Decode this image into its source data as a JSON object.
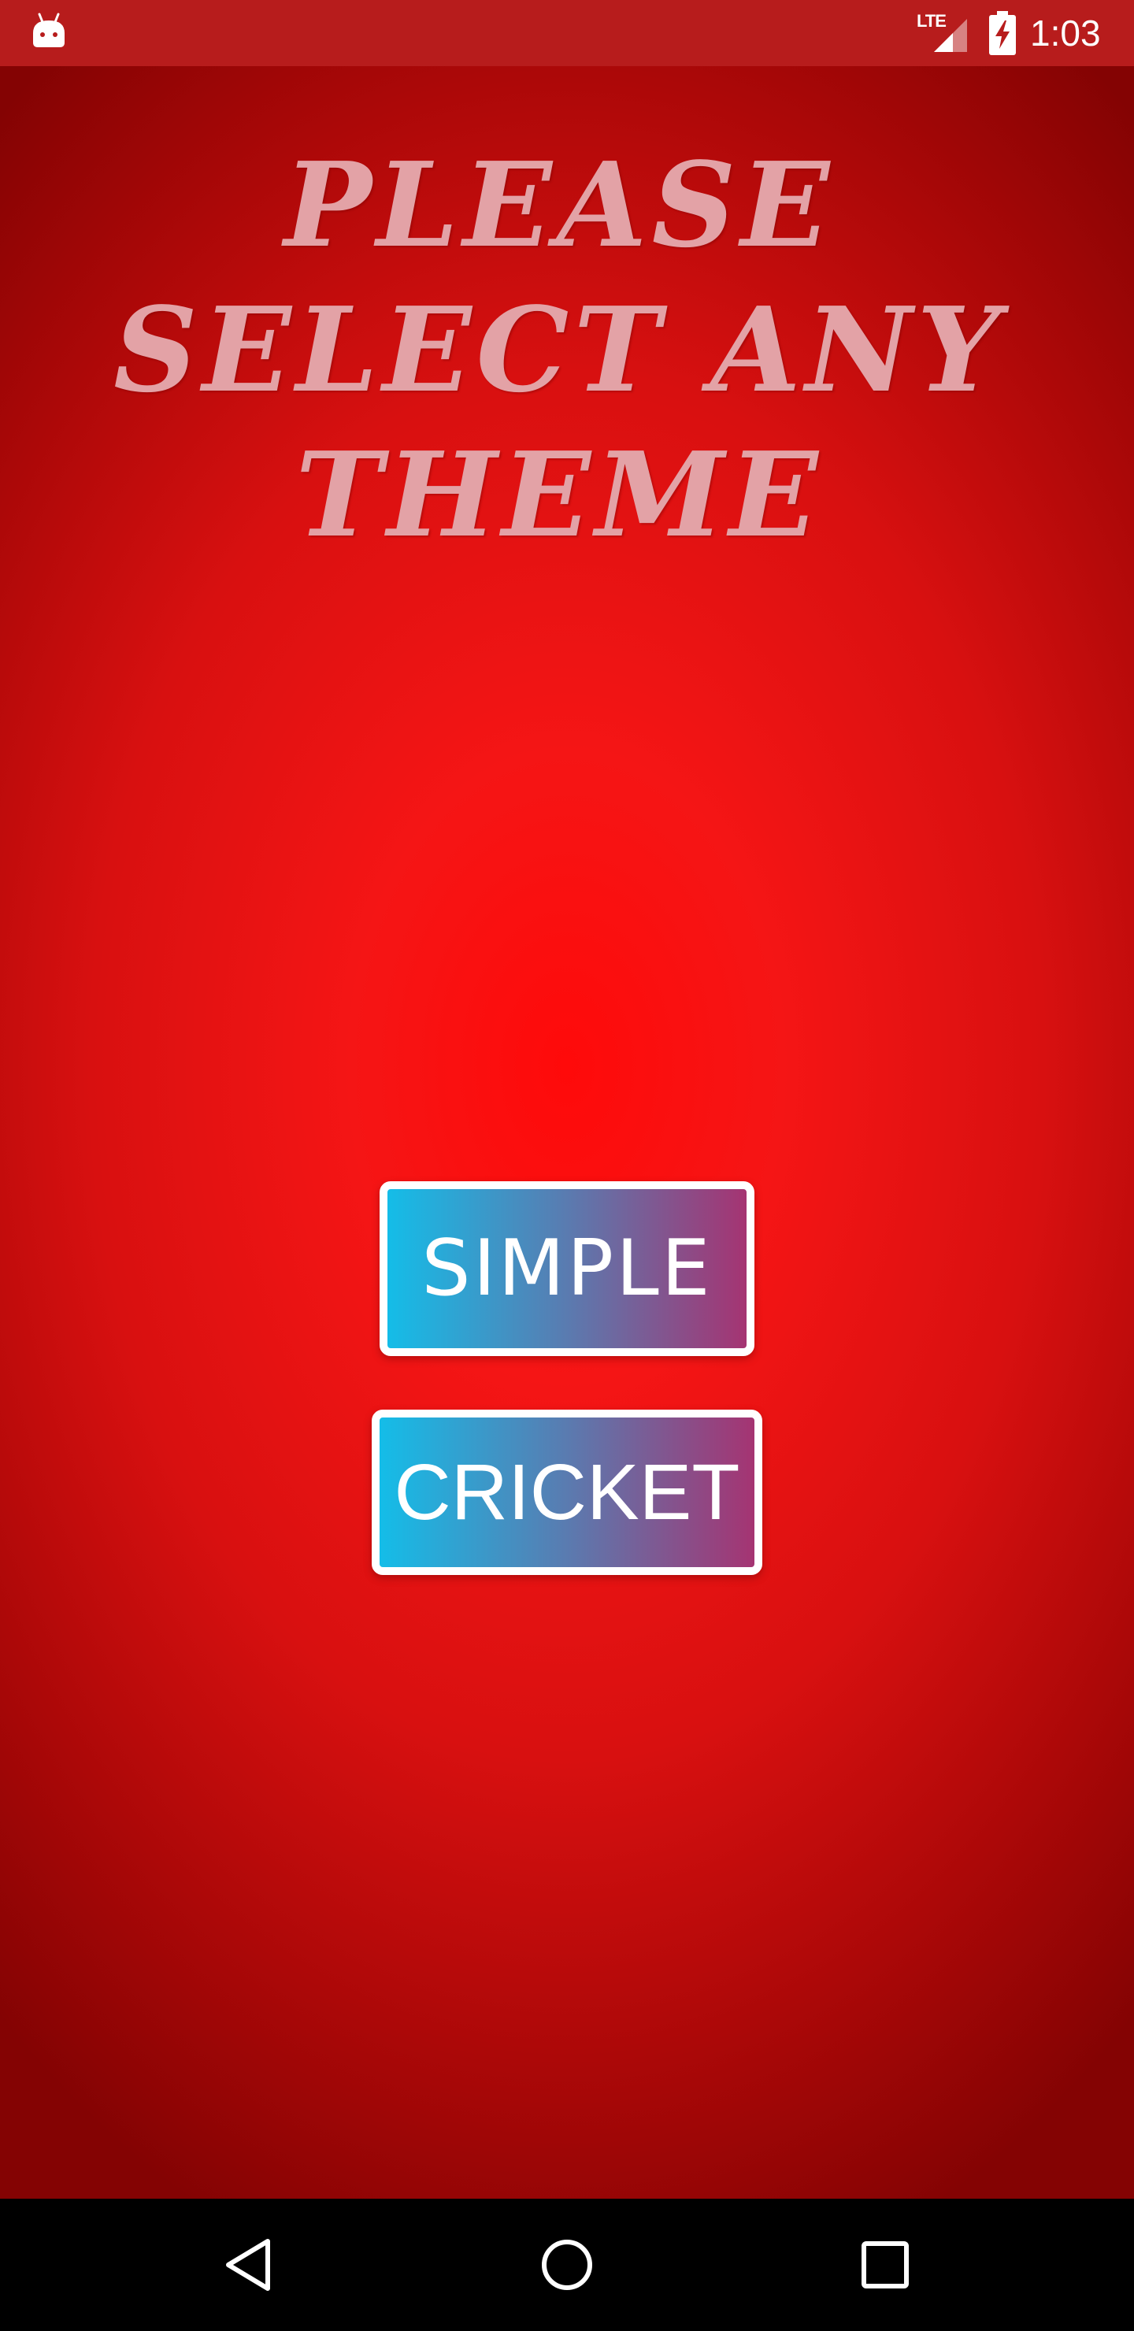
{
  "status_bar": {
    "network_label": "LTE",
    "time": "1:03",
    "icons": [
      "android-icon",
      "signal-icon",
      "battery-charging-icon"
    ],
    "color": "#b71c1c"
  },
  "screen": {
    "heading": "PLEASE SELECT ANY THEME",
    "heading_color": "#e3a2a6",
    "background_colors": [
      "#ff0a0a",
      "#840303"
    ],
    "buttons": [
      {
        "label": "SIMPLE"
      },
      {
        "label": "CRICKET"
      }
    ],
    "button_gradient": [
      "#14bde8",
      "#a53472"
    ]
  },
  "nav_bar": {
    "icons": [
      "back-icon",
      "home-icon",
      "recents-icon"
    ]
  }
}
